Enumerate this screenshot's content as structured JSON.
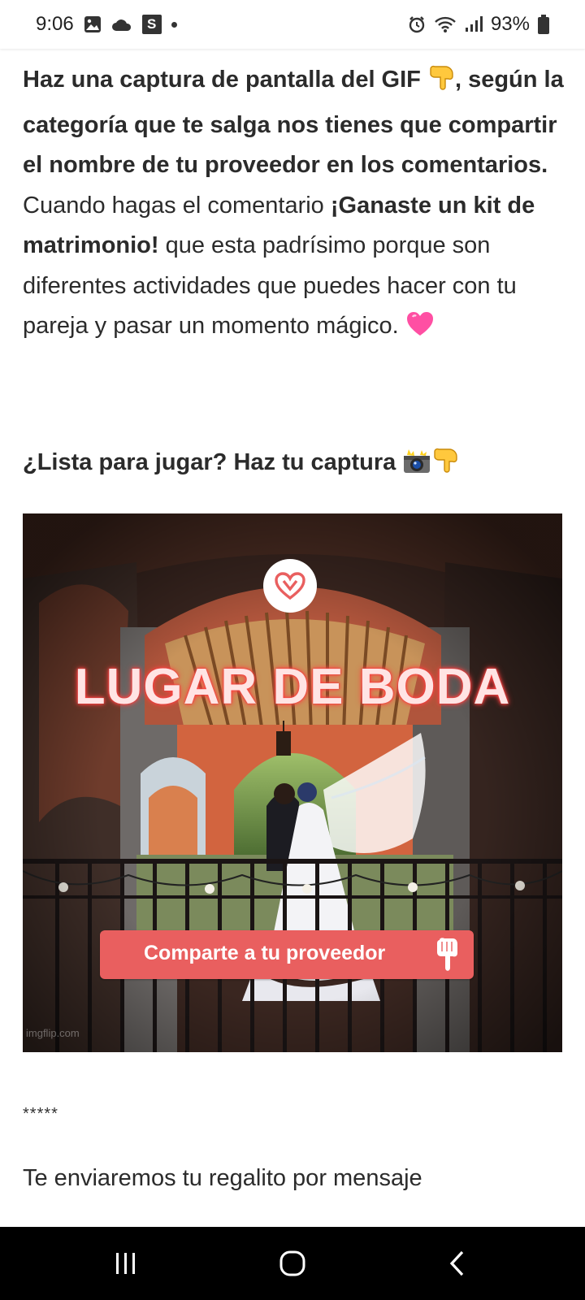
{
  "status_bar": {
    "time": "9:06",
    "battery": "93%",
    "icons": [
      "gallery-icon",
      "cloud-icon",
      "s-app-icon",
      "notification-dot",
      "alarm-icon",
      "wifi-icon",
      "signal-icon",
      "battery-icon"
    ],
    "s_badge": "S"
  },
  "post": {
    "segments": [
      {
        "text": "Haz una captura de pantalla del GIF ",
        "bold": true
      },
      {
        "emoji": "point-down-hand-emoji"
      },
      {
        "text": ", según la categoría que te salga nos tienes que compartir el nombre de tu proveedor en los comentarios.",
        "bold": true
      },
      {
        "text": " Cuando hagas el comentario ",
        "bold": false
      },
      {
        "text": "¡Ganaste un kit de matrimonio!",
        "bold": true
      },
      {
        "text": " que esta padrísimo porque son diferentes actividades que puedes hacer con tu pareja y pasar un momento mágico. ",
        "bold": false
      },
      {
        "emoji": "pink-heart-emoji"
      }
    ],
    "headline": "¿Lista para jugar? Haz tu captura",
    "headline_emojis": [
      "camera-flash-emoji",
      "point-down-hand-emoji"
    ]
  },
  "gif": {
    "title": "LUGAR DE BODA",
    "button_label": "Comparte a tu proveedor",
    "watermark": "imgflip.com",
    "colors": {
      "accent": "#e95f5f",
      "title_glow": "#ff3b3b"
    }
  },
  "footer": {
    "stars": "*****",
    "text": "Te enviaremos tu regalito por mensaje"
  },
  "nav": {
    "buttons": [
      "recents-button",
      "home-button",
      "back-button"
    ]
  }
}
